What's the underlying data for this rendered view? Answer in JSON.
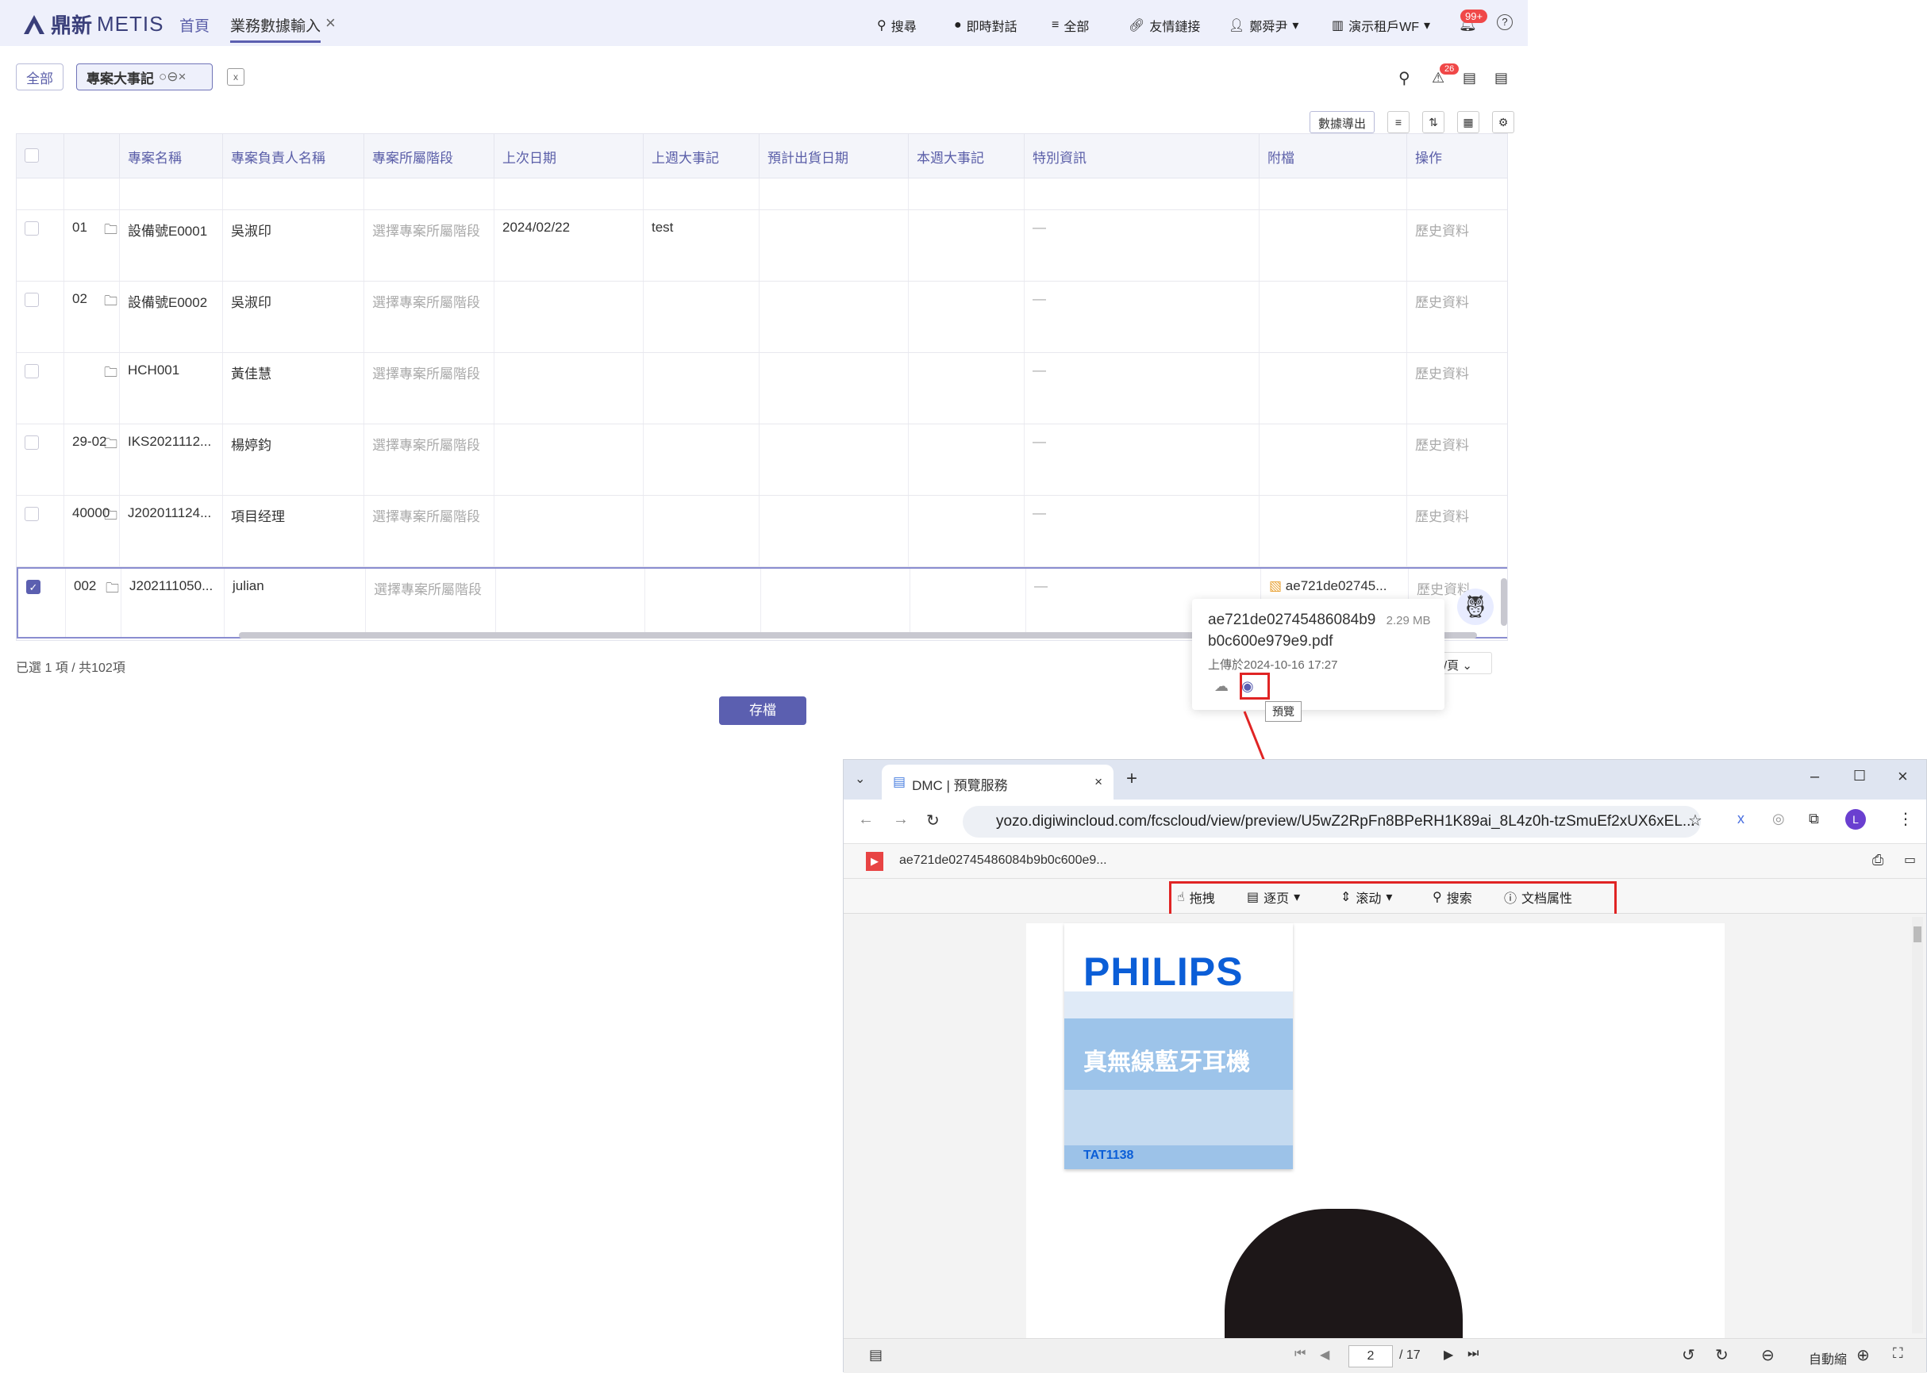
{
  "topnav": {
    "logo_text": "鼎新",
    "logo_brand": "METIS",
    "links": [
      "首頁",
      "業務數據輸入"
    ],
    "tools": [
      {
        "icon": "search-icon",
        "label": "搜尋"
      },
      {
        "icon": "chat-icon",
        "label": "即時對話"
      },
      {
        "icon": "list-icon",
        "label": "全部"
      },
      {
        "icon": "link-icon",
        "label": "友情鏈接"
      },
      {
        "icon": "user-icon",
        "label": "鄭舜尹"
      },
      {
        "icon": "building-icon",
        "label": "演示租戶WF"
      }
    ],
    "notify_badge": "99+"
  },
  "filters": {
    "all": "全部",
    "active": "專案大事記"
  },
  "header_badge": "26",
  "toolbar": {
    "export": "數據導出"
  },
  "table": {
    "columns": [
      "專案名稱",
      "專案負責人名稱",
      "專案所屬階段",
      "上次日期",
      "上週大事記",
      "預計出貨日期",
      "本週大事記",
      "特別資訊",
      "附檔",
      "操作"
    ],
    "rows": [
      {
        "code": "01",
        "name": "設備號E0001",
        "owner": "吳淑印",
        "stage": "選擇專案所屬階段",
        "last_date": "2024/02/22",
        "last_week": "test",
        "special": "—",
        "file": "",
        "action": "歷史資料",
        "checked": false
      },
      {
        "code": "02",
        "name": "設備號E0002",
        "owner": "吳淑印",
        "stage": "選擇專案所屬階段",
        "last_date": "",
        "last_week": "",
        "special": "—",
        "file": "",
        "action": "歷史資料",
        "checked": false
      },
      {
        "code": "",
        "name": "HCH001",
        "owner": "黃佳慧",
        "stage": "選擇專案所屬階段",
        "last_date": "",
        "last_week": "",
        "special": "—",
        "file": "",
        "action": "歷史資料",
        "checked": false
      },
      {
        "code": "29-02",
        "name": "IKS2021112...",
        "owner": "楊婷鈞",
        "stage": "選擇專案所屬階段",
        "last_date": "",
        "last_week": "",
        "special": "—",
        "file": "",
        "action": "歷史資料",
        "checked": false
      },
      {
        "code": "40000",
        "name": "J202011124...",
        "owner": "項目经理",
        "stage": "選擇專案所屬階段",
        "last_date": "",
        "last_week": "",
        "special": "—",
        "file": "",
        "action": "歷史資料",
        "checked": false
      },
      {
        "code": "002",
        "name": "J202111050...",
        "owner": "julian",
        "stage": "選擇專案所屬階段",
        "last_date": "",
        "last_week": "",
        "special": "—",
        "file": "ae721de02745...",
        "action": "歷史資料",
        "checked": true
      }
    ]
  },
  "selection_summary": "已選 1 項 / 共102項",
  "pager_suffix": "/頁",
  "save_button": "存檔",
  "popover": {
    "filename_line1": "ae721de02745486084b9",
    "filename_line2": "b0c600e979e9.pdf",
    "size": "2.29 MB",
    "uploaded": "上傳於2024-10-16 17:27",
    "tooltip": "預覽"
  },
  "browser": {
    "tab_title": "DMC | 預覽服務",
    "url": "yozo.digiwincloud.com/fcscloud/view/preview/U5wZ2RpFn8BPeRH1K89ai_8L4z0h-tzSmuEf2xUX6xEL...",
    "profile": "L",
    "file_title": "ae721de02745486084b9b0c600e9...",
    "pdf_tools": [
      {
        "icon": "hand-icon",
        "label": "拖拽"
      },
      {
        "icon": "page-icon",
        "label": "逐页"
      },
      {
        "icon": "scroll-icon",
        "label": "滚动"
      },
      {
        "icon": "search-icon",
        "label": "搜索"
      },
      {
        "icon": "info-icon",
        "label": "文档属性"
      }
    ],
    "page_current": "2",
    "page_total": "/ 17",
    "zoom": "自動縮"
  },
  "document": {
    "brand": "PHILIPS",
    "product_title": "真無線藍牙耳機",
    "model": "TAT1138"
  },
  "colors": {
    "accent": "#5b5fb0",
    "highlight": "#e02424",
    "brand": "#0b5ed7"
  }
}
